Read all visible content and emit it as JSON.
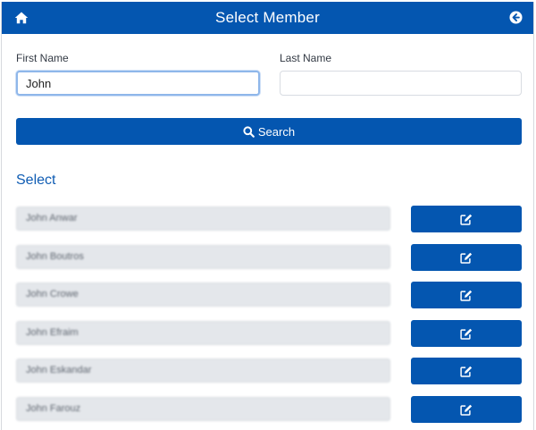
{
  "header": {
    "title": "Select Member",
    "home_icon": "home-icon",
    "back_icon": "arrow-circle-left-icon",
    "background_color": "#0456b0"
  },
  "form": {
    "first_name_label": "First Name",
    "first_name_value": "John",
    "last_name_label": "Last Name",
    "last_name_value": "",
    "search_label": "Search",
    "search_icon": "search-icon"
  },
  "results": {
    "title": "Select",
    "edit_icon": "edit-icon",
    "members": [
      {
        "name": "John Anwar"
      },
      {
        "name": "John Boutros"
      },
      {
        "name": "John Crowe"
      },
      {
        "name": "John Efraim"
      },
      {
        "name": "John Eskandar"
      },
      {
        "name": "John Farouz"
      }
    ]
  }
}
